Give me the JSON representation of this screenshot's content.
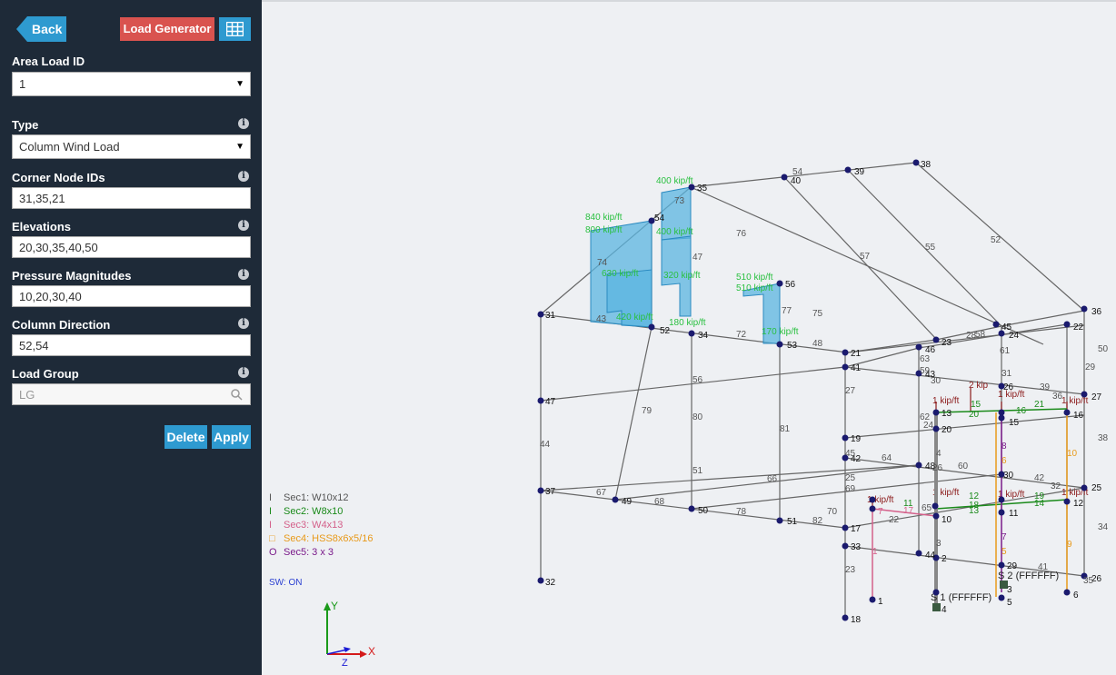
{
  "sidebar": {
    "back_label": "Back",
    "load_generator_label": "Load Generator",
    "area_load_id": {
      "label": "Area Load ID",
      "value": "1"
    },
    "type": {
      "label": "Type",
      "value": "Column Wind Load"
    },
    "corner_nodes": {
      "label": "Corner Node IDs",
      "value": "31,35,21"
    },
    "elevations": {
      "label": "Elevations",
      "value": "20,30,35,40,50"
    },
    "pressure": {
      "label": "Pressure Magnitudes",
      "value": "10,20,30,40"
    },
    "column_direction": {
      "label": "Column Direction",
      "value": "52,54"
    },
    "load_group": {
      "label": "Load Group",
      "value": "",
      "placeholder": "LG"
    },
    "delete_label": "Delete",
    "apply_label": "Apply"
  },
  "legend": {
    "items": [
      {
        "symbol": "I",
        "label": "Sec1: W10x12",
        "color": "#555555"
      },
      {
        "symbol": "I",
        "label": "Sec2: W8x10",
        "color": "#1a8a1a"
      },
      {
        "symbol": "I",
        "label": "Sec3: W4x13",
        "color": "#d4608a"
      },
      {
        "symbol": "□",
        "label": "Sec4: HSS8x6x5/16",
        "color": "#e89a1a"
      },
      {
        "symbol": "O",
        "label": "Sec5: 3 x 3",
        "color": "#7a1a8a"
      }
    ],
    "sw_note": "SW: ON"
  },
  "axes": {
    "y": "Y",
    "x": "X",
    "z": "Z"
  },
  "colors": {
    "sidebar_bg": "#1e2a38",
    "accent_blue": "#2e9ad0",
    "danger_red": "#d9534f",
    "node": "#1a1a6e",
    "member": "#555555",
    "wind_load": "#3aa8d8",
    "wind_text": "#2ac040",
    "point_load": "#8b1a1a",
    "support": "#3a5a40"
  }
}
